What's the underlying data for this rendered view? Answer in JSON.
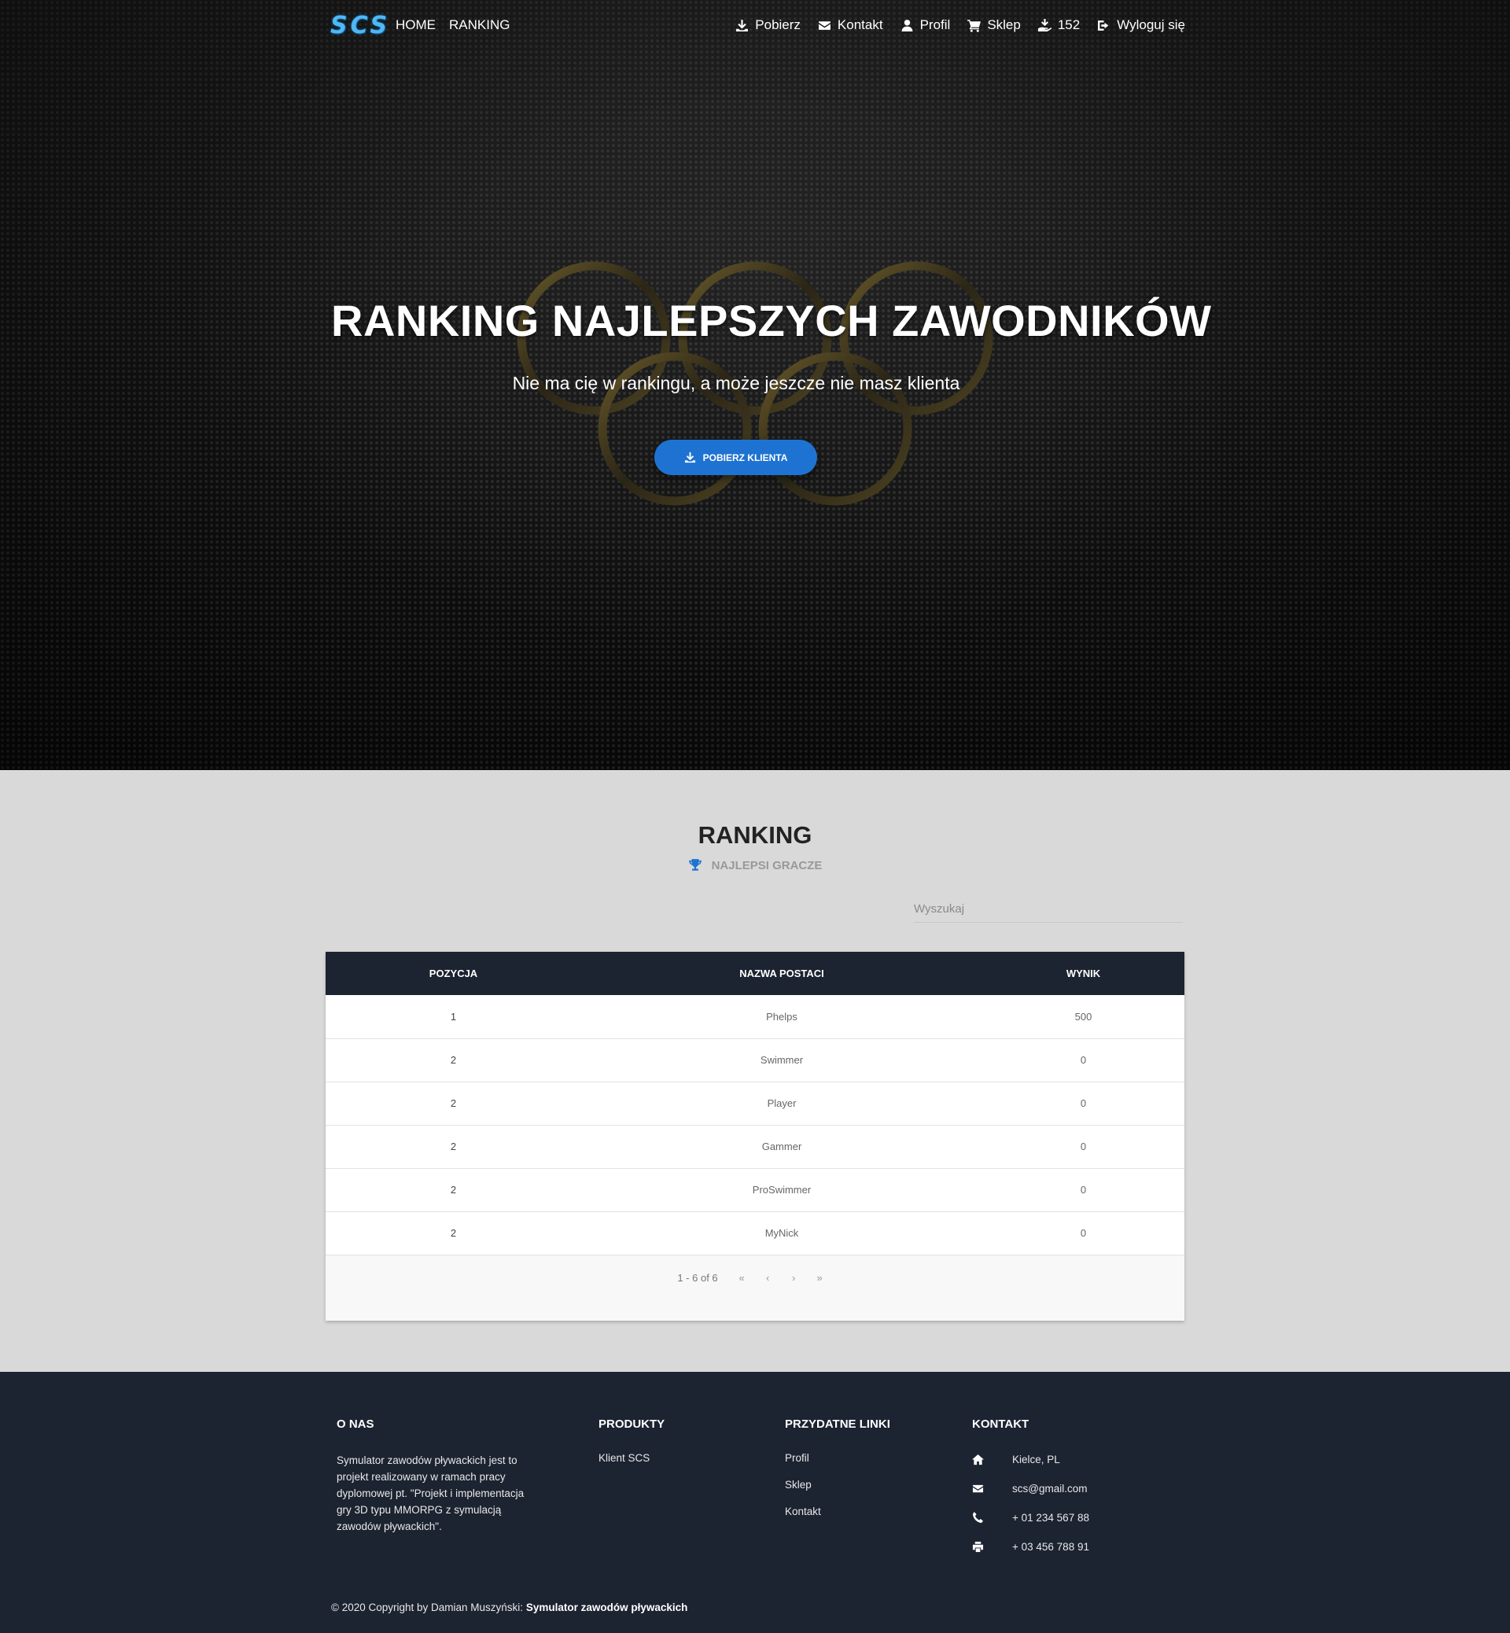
{
  "nav": {
    "brand": "SCS",
    "left": [
      {
        "label": "HOME"
      },
      {
        "label": "RANKING"
      }
    ],
    "right": [
      {
        "label": "Pobierz",
        "icon": "download-icon"
      },
      {
        "label": "Kontakt",
        "icon": "envelope-icon"
      },
      {
        "label": "Profil",
        "icon": "user-icon"
      },
      {
        "label": "Sklep",
        "icon": "cart-icon"
      },
      {
        "label": "152",
        "icon": "coins-icon"
      },
      {
        "label": "Wyloguj się",
        "icon": "sign-out-icon"
      }
    ]
  },
  "hero": {
    "title": "RANKING NAJLEPSZYCH ZAWODNIKÓW",
    "subtitle": "Nie ma cię w rankingu, a może jeszcze nie masz klienta",
    "button_label": "POBIERZ KLIENTA",
    "button_icon": "download-icon",
    "button_color": "#1e73d2"
  },
  "ranking": {
    "title": "RANKING",
    "subtitle": "NAJLEPSI GRACZE",
    "subtitle_icon": "trophy-icon",
    "search_placeholder": "Wyszukaj",
    "columns": [
      "POZYCJA",
      "NAZWA POSTACI",
      "WYNIK"
    ],
    "rows": [
      {
        "pos": "1",
        "name": "Phelps",
        "score": "500"
      },
      {
        "pos": "2",
        "name": "Swimmer",
        "score": "0"
      },
      {
        "pos": "2",
        "name": "Player",
        "score": "0"
      },
      {
        "pos": "2",
        "name": "Gammer",
        "score": "0"
      },
      {
        "pos": "2",
        "name": "ProSwimmer",
        "score": "0"
      },
      {
        "pos": "2",
        "name": "MyNick",
        "score": "0"
      }
    ],
    "pagination": {
      "info": "1 - 6 of 6",
      "first": "«",
      "prev": "‹",
      "next": "›",
      "last": "»"
    }
  },
  "footer": {
    "about": {
      "heading": "O NAS",
      "text": "Symulator zawodów pływackich jest to projekt realizowany w ramach pracy dyplomowej pt. \"Projekt i implementacja gry 3D typu MMORPG z symulacją zawodów pływackich\"."
    },
    "products": {
      "heading": "PRODUKTY",
      "links": [
        "Klient SCS"
      ]
    },
    "useful": {
      "heading": "PRZYDATNE LINKI",
      "links": [
        "Profil",
        "Sklep",
        "Kontakt"
      ]
    },
    "contact": {
      "heading": "KONTAKT",
      "items": [
        {
          "icon": "home-icon",
          "text": "Kielce, PL"
        },
        {
          "icon": "envelope-icon",
          "text": "scs@gmail.com"
        },
        {
          "icon": "phone-icon",
          "text": "+ 01 234 567 88"
        },
        {
          "icon": "print-icon",
          "text": "+ 03 456 788 91"
        }
      ]
    },
    "copyright_prefix": "© 2020 Copyright by Damian Muszyński: ",
    "copyright_link": "Symulator zawodów pływackich"
  },
  "colors": {
    "navy": "#1c2331",
    "accent": "#1e73d2",
    "section_bg": "#d9d9d9"
  }
}
